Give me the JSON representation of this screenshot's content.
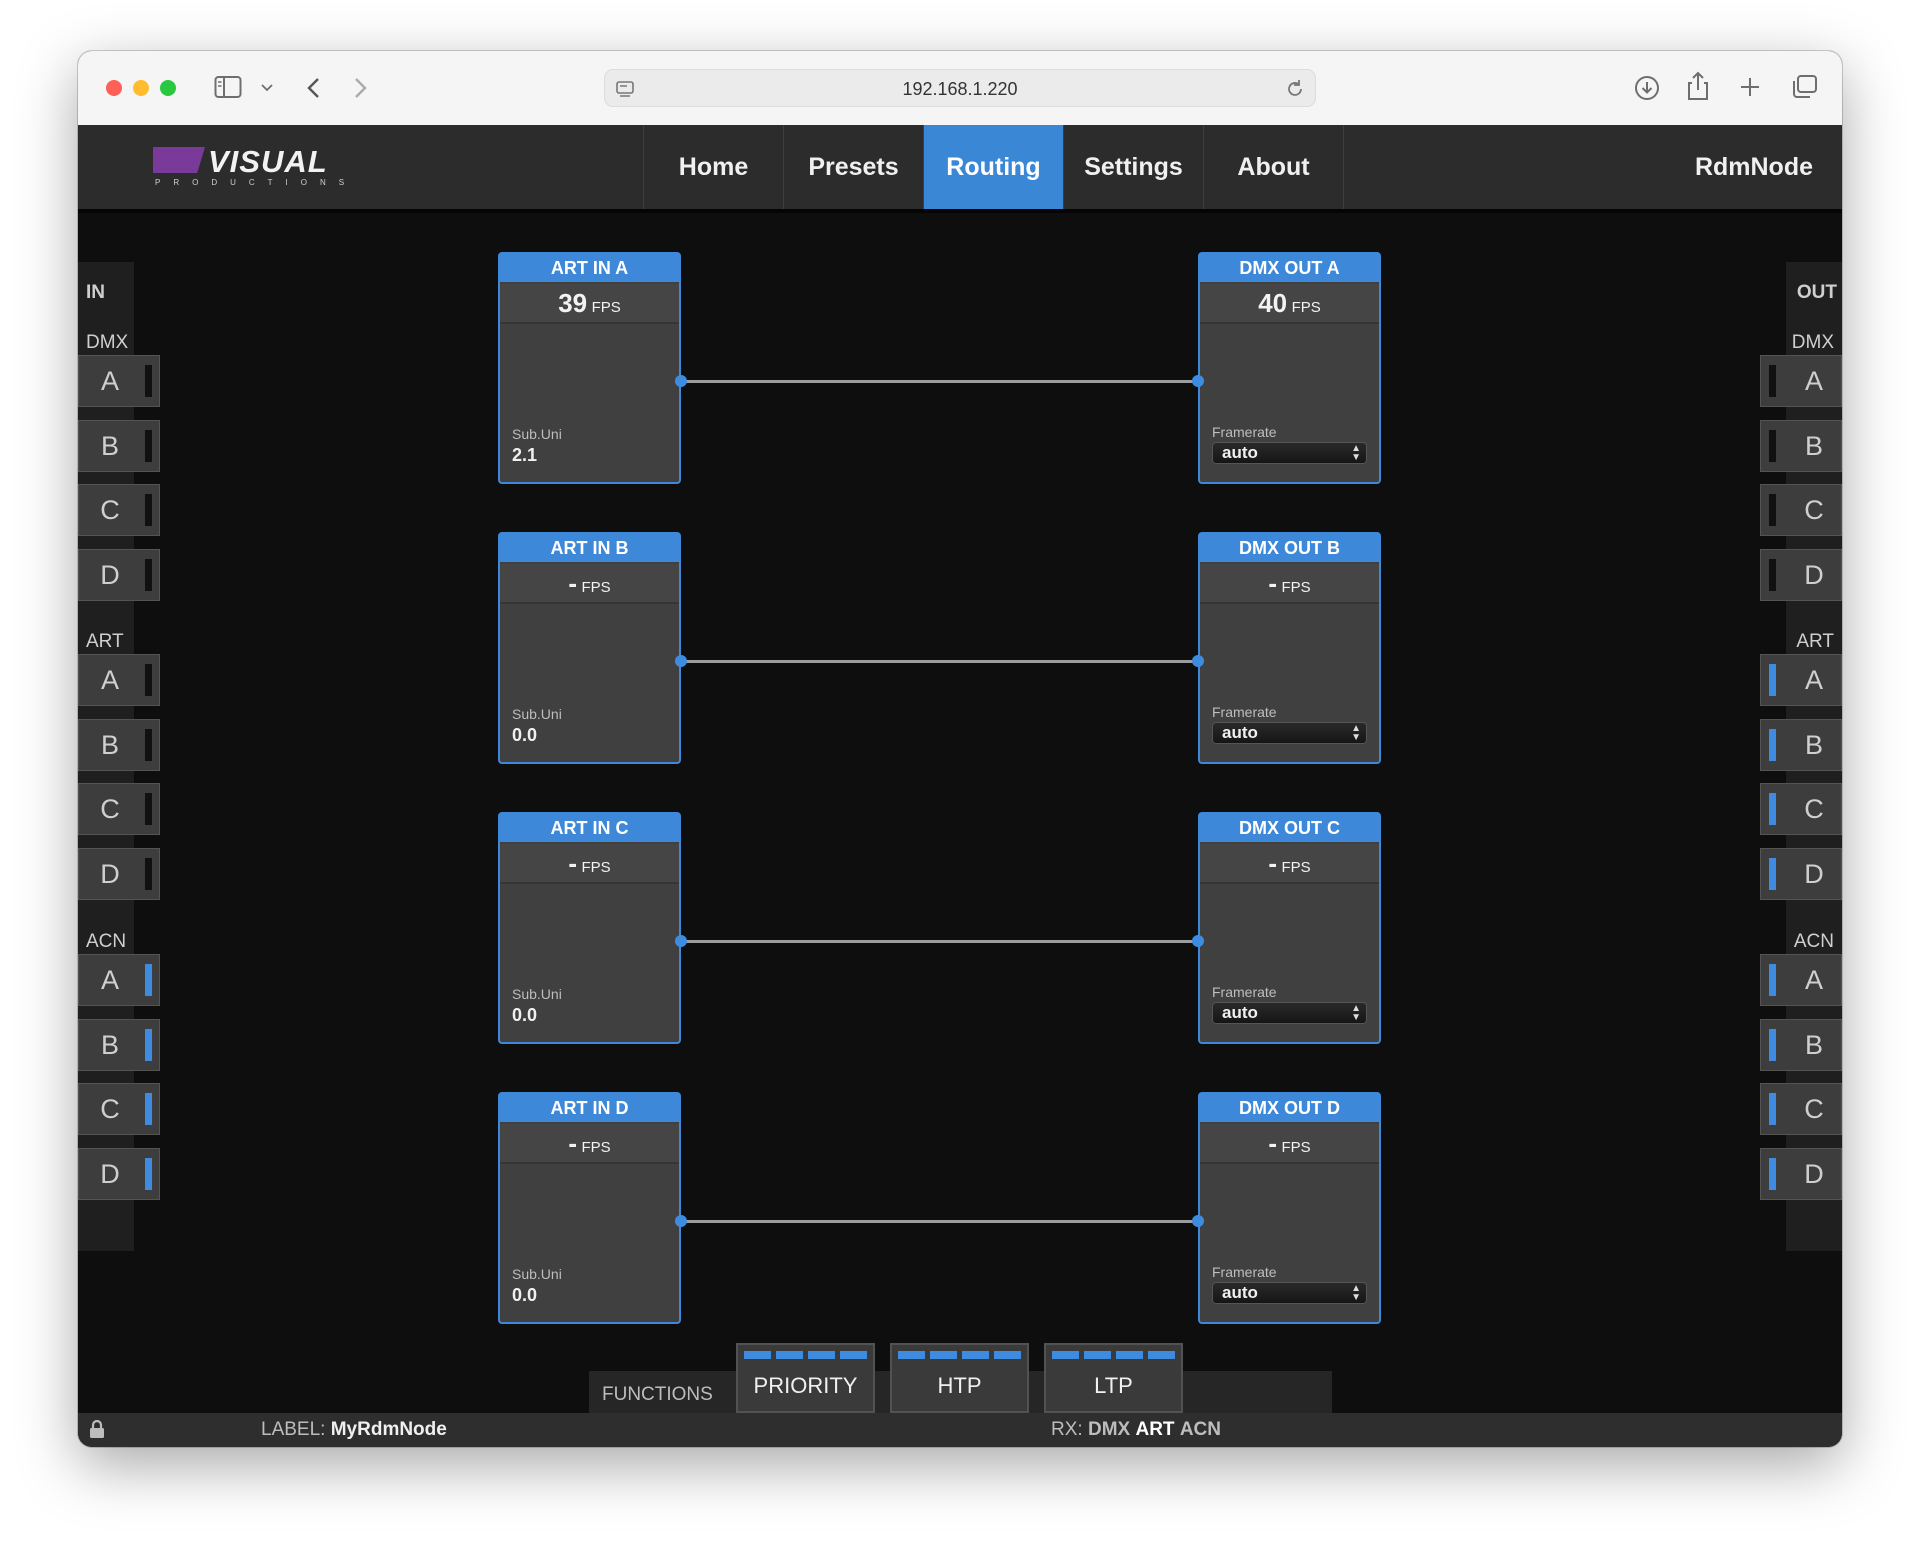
{
  "browser": {
    "url": "192.168.1.220"
  },
  "app": {
    "logo_text": "VISUAL",
    "logo_subtext": "PRODUCTIONS",
    "device_name": "RdmNode",
    "nav": [
      {
        "label": "Home",
        "active": false
      },
      {
        "label": "Presets",
        "active": false
      },
      {
        "label": "Routing",
        "active": true
      },
      {
        "label": "Settings",
        "active": false
      },
      {
        "label": "About",
        "active": false
      }
    ]
  },
  "left_panel": {
    "title": "IN",
    "groups": [
      {
        "label": "DMX",
        "channels": [
          {
            "letter": "A",
            "active": false
          },
          {
            "letter": "B",
            "active": false
          },
          {
            "letter": "C",
            "active": false
          },
          {
            "letter": "D",
            "active": false
          }
        ]
      },
      {
        "label": "ART",
        "channels": [
          {
            "letter": "A",
            "active": false
          },
          {
            "letter": "B",
            "active": false
          },
          {
            "letter": "C",
            "active": false
          },
          {
            "letter": "D",
            "active": false
          }
        ]
      },
      {
        "label": "ACN",
        "channels": [
          {
            "letter": "A",
            "active": true
          },
          {
            "letter": "B",
            "active": true
          },
          {
            "letter": "C",
            "active": true
          },
          {
            "letter": "D",
            "active": true
          }
        ]
      }
    ]
  },
  "right_panel": {
    "title": "OUT",
    "groups": [
      {
        "label": "DMX",
        "channels": [
          {
            "letter": "A",
            "active": false
          },
          {
            "letter": "B",
            "active": false
          },
          {
            "letter": "C",
            "active": false
          },
          {
            "letter": "D",
            "active": false
          }
        ]
      },
      {
        "label": "ART",
        "channels": [
          {
            "letter": "A",
            "active": true
          },
          {
            "letter": "B",
            "active": true
          },
          {
            "letter": "C",
            "active": true
          },
          {
            "letter": "D",
            "active": true
          }
        ]
      },
      {
        "label": "ACN",
        "channels": [
          {
            "letter": "A",
            "active": true
          },
          {
            "letter": "B",
            "active": true
          },
          {
            "letter": "C",
            "active": true
          },
          {
            "letter": "D",
            "active": true
          }
        ]
      }
    ]
  },
  "routes": [
    {
      "input": {
        "title": "ART IN A",
        "fps": "39",
        "fps_unit": "FPS",
        "field_label": "Sub.Uni",
        "field_value": "2.1"
      },
      "output": {
        "title": "DMX OUT A",
        "fps": "40",
        "fps_unit": "FPS",
        "field_label": "Framerate",
        "framerate": "auto"
      }
    },
    {
      "input": {
        "title": "ART IN B",
        "fps": "-",
        "fps_unit": "FPS",
        "field_label": "Sub.Uni",
        "field_value": "0.0"
      },
      "output": {
        "title": "DMX OUT B",
        "fps": "-",
        "fps_unit": "FPS",
        "field_label": "Framerate",
        "framerate": "auto"
      }
    },
    {
      "input": {
        "title": "ART IN C",
        "fps": "-",
        "fps_unit": "FPS",
        "field_label": "Sub.Uni",
        "field_value": "0.0"
      },
      "output": {
        "title": "DMX OUT C",
        "fps": "-",
        "fps_unit": "FPS",
        "field_label": "Framerate",
        "framerate": "auto"
      }
    },
    {
      "input": {
        "title": "ART IN D",
        "fps": "-",
        "fps_unit": "FPS",
        "field_label": "Sub.Uni",
        "field_value": "0.0"
      },
      "output": {
        "title": "DMX OUT D",
        "fps": "-",
        "fps_unit": "FPS",
        "field_label": "Framerate",
        "framerate": "auto"
      }
    }
  ],
  "functions": {
    "label": "FUNCTIONS",
    "buttons": [
      {
        "label": "PRIORITY"
      },
      {
        "label": "HTP"
      },
      {
        "label": "LTP"
      }
    ]
  },
  "status": {
    "label_key": "LABEL:",
    "label_value": "MyRdmNode",
    "rx_key": "RX:",
    "rx_items": [
      {
        "label": "DMX",
        "active": false
      },
      {
        "label": "ART",
        "active": true
      },
      {
        "label": "ACN",
        "active": false
      }
    ]
  },
  "colors": {
    "accent": "#3d88d8",
    "indicator_on": "#3d8ce0"
  }
}
